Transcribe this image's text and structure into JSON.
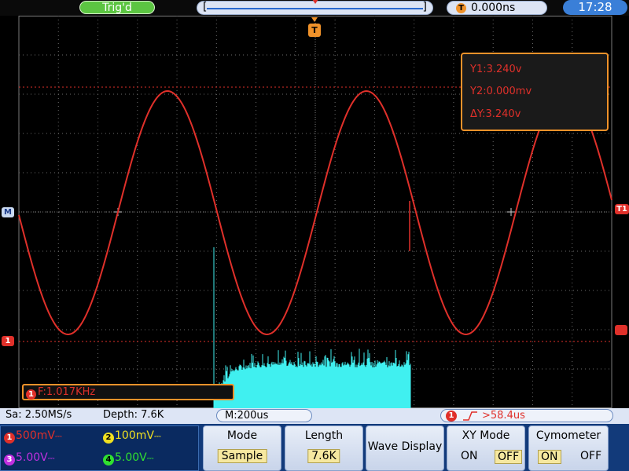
{
  "header": {
    "trigger_status": "Trig'd",
    "horizontal_position": "0.000ns",
    "clock": "17:28"
  },
  "markers": {
    "trigger_top": "T",
    "math_left": "M",
    "ch1_left": "1",
    "t1_right": "T1"
  },
  "cursor_readout": {
    "y1": "Y1:3.240v",
    "y2": "Y2:0.000mv",
    "dy": "ΔY:3.240v"
  },
  "frequency_readout": {
    "channel": "1",
    "value": "F:1.017KHz"
  },
  "status": {
    "sample_rate": "Sa: 2.50MS/s",
    "depth": "Depth: 7.6K",
    "timebase": "M:200us",
    "trigger_channel": "1",
    "trigger_level": ">58.4us"
  },
  "channels": [
    {
      "id": "1",
      "scale": "500mV",
      "coupling": "DC",
      "color": "#e0302a"
    },
    {
      "id": "2",
      "scale": "100mV",
      "coupling": "DC",
      "color": "#f0e020"
    },
    {
      "id": "3",
      "scale": "5.00V",
      "coupling": "DC",
      "color": "#c030e0"
    },
    {
      "id": "4",
      "scale": "5.00V",
      "coupling": "DC",
      "color": "#30e030"
    }
  ],
  "menu": {
    "mode": {
      "title": "Mode",
      "value": "Sample"
    },
    "length": {
      "title": "Length",
      "value": "7.6K"
    },
    "wave_display": {
      "title": "Wave Display"
    },
    "xy_mode": {
      "title": "XY Mode",
      "on": "ON",
      "off": "OFF",
      "selected": "OFF"
    },
    "cymometer": {
      "title": "Cymometer",
      "on": "ON",
      "off": "OFF",
      "selected": "ON"
    }
  },
  "colors": {
    "ch1": "#e0302a",
    "ch2_trace": "#40f0f0",
    "accent": "#f0922a",
    "grid": "#8a8a8a"
  }
}
